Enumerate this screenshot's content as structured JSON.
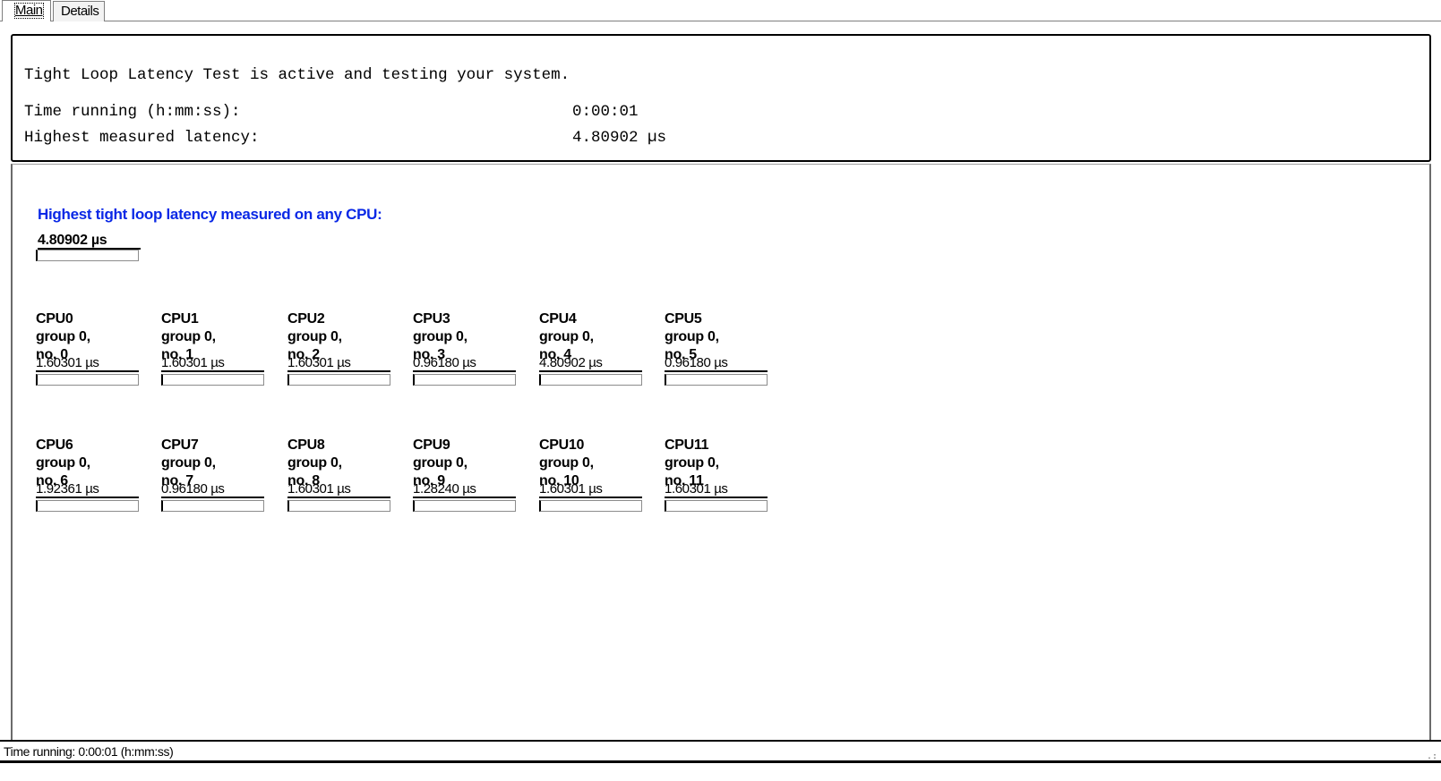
{
  "tabs": [
    {
      "label": "Main",
      "active": true
    },
    {
      "label": "Details",
      "active": false
    }
  ],
  "status": {
    "message": "Tight Loop Latency Test is active and testing your system.",
    "time_label": "Time running (h:mm:ss):",
    "time_value": "0:00:01",
    "highest_label": "Highest measured latency:",
    "highest_value": "4.80902 µs"
  },
  "overall": {
    "heading": "Highest tight loop latency measured on any CPU:",
    "value": "4.80902 µs",
    "fill": 0.0
  },
  "cpus": [
    {
      "name": "CPU0",
      "group": "group 0,",
      "no": "no. 0",
      "value": "1.60301 µs",
      "fill": 0.0
    },
    {
      "name": "CPU1",
      "group": "group 0,",
      "no": "no. 1",
      "value": "1.60301 µs",
      "fill": 0.0
    },
    {
      "name": "CPU2",
      "group": "group 0,",
      "no": "no. 2",
      "value": "1.60301 µs",
      "fill": 0.0
    },
    {
      "name": "CPU3",
      "group": "group 0,",
      "no": "no. 3",
      "value": "0.96180 µs",
      "fill": 0.0
    },
    {
      "name": "CPU4",
      "group": "group 0,",
      "no": "no. 4",
      "value": "4.80902 µs",
      "fill": 0.0
    },
    {
      "name": "CPU5",
      "group": "group 0,",
      "no": "no. 5",
      "value": "0.96180 µs",
      "fill": 0.0
    },
    {
      "name": "CPU6",
      "group": "group 0,",
      "no": "no. 6",
      "value": "1.92361 µs",
      "fill": 0.0
    },
    {
      "name": "CPU7",
      "group": "group 0,",
      "no": "no. 7",
      "value": "0.96180 µs",
      "fill": 0.0
    },
    {
      "name": "CPU8",
      "group": "group 0,",
      "no": "no. 8",
      "value": "1.60301 µs",
      "fill": 0.0
    },
    {
      "name": "CPU9",
      "group": "group 0,",
      "no": "no. 9",
      "value": "1.28240 µs",
      "fill": 0.0
    },
    {
      "name": "CPU10",
      "group": "group 0,",
      "no": "no. 10",
      "value": "1.60301 µs",
      "fill": 0.0
    },
    {
      "name": "CPU11",
      "group": "group 0,",
      "no": "no. 11",
      "value": "1.60301 µs",
      "fill": 0.0
    }
  ],
  "statusbar": {
    "text": "Time running: 0:00:01  (h:mm:ss)"
  },
  "colors": {
    "heading_blue": "#0a28e6",
    "bar_fill": "#3cb043"
  }
}
